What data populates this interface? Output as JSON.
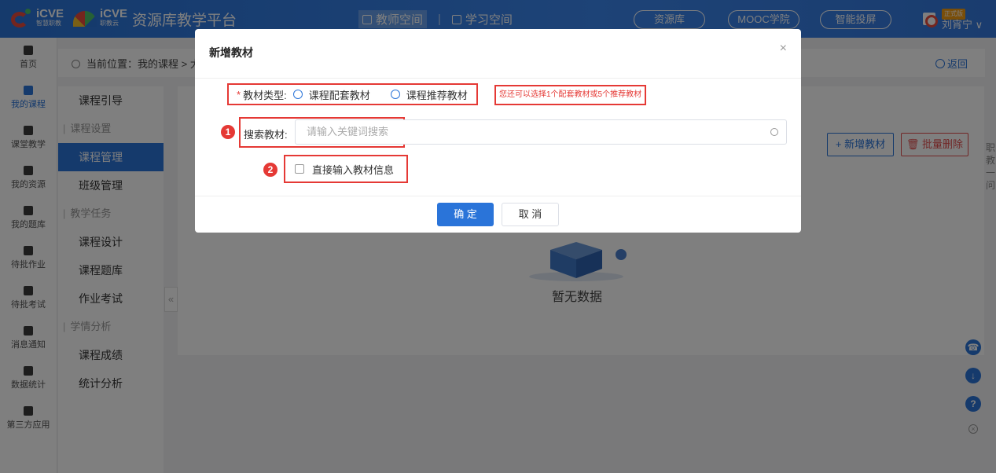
{
  "topbar": {
    "logo1_text": "iCVE",
    "logo1_sub": "智慧职教",
    "logo2_text": "iCVE",
    "logo2_sub": "职教云",
    "platform_title": "资源库教学平台",
    "teacher_space": "教师空间",
    "student_space": "学习空间",
    "pills": [
      "资源库",
      "MOOC学院",
      "智能投屏"
    ],
    "badge": "正式版",
    "user_name": "刘宵宁 ∨"
  },
  "rail": {
    "items": [
      "首页",
      "我的课程",
      "课堂教学",
      "我的资源",
      "我的题库",
      "待批作业",
      "待批考试",
      "消息通知",
      "数据统计",
      "第三方应用"
    ]
  },
  "breadcrumb": {
    "text": "当前位置：我的课程 > 大",
    "back_label": "返回"
  },
  "menu": {
    "items": [
      {
        "label": "课程引导",
        "type": "item"
      },
      {
        "label": "课程设置",
        "type": "group"
      },
      {
        "label": "课程管理",
        "type": "selected"
      },
      {
        "label": "班级管理",
        "type": "item"
      },
      {
        "label": "教学任务",
        "type": "group"
      },
      {
        "label": "课程设计",
        "type": "item"
      },
      {
        "label": "课程题库",
        "type": "item"
      },
      {
        "label": "作业考试",
        "type": "item"
      },
      {
        "label": "学情分析",
        "type": "group"
      },
      {
        "label": "课程成绩",
        "type": "item"
      },
      {
        "label": "统计分析",
        "type": "item"
      }
    ],
    "collapse_glyph": "«"
  },
  "content": {
    "add_button": "+ 新增教材",
    "delete_button": "批量删除",
    "empty_text": "暂无数据",
    "right_edge_text": "职教一问"
  },
  "modal": {
    "title": "新增教材",
    "close": "×",
    "required_mark": "*",
    "type_label": "教材类型:",
    "radio_options": [
      "课程配套教材",
      "课程推荐教材"
    ],
    "hint": "您还可以选择1个配套教材或5个推荐教材",
    "step1": "1",
    "step2": "2",
    "search_label": "搜索教材:",
    "search_placeholder": "请输入关键词搜索",
    "direct_input_label": "直接输入教材信息",
    "ok_button": "确 定",
    "cancel_button": "取 消"
  },
  "colors": {
    "primary": "#2a74d9",
    "annotation_red": "#e53935"
  }
}
